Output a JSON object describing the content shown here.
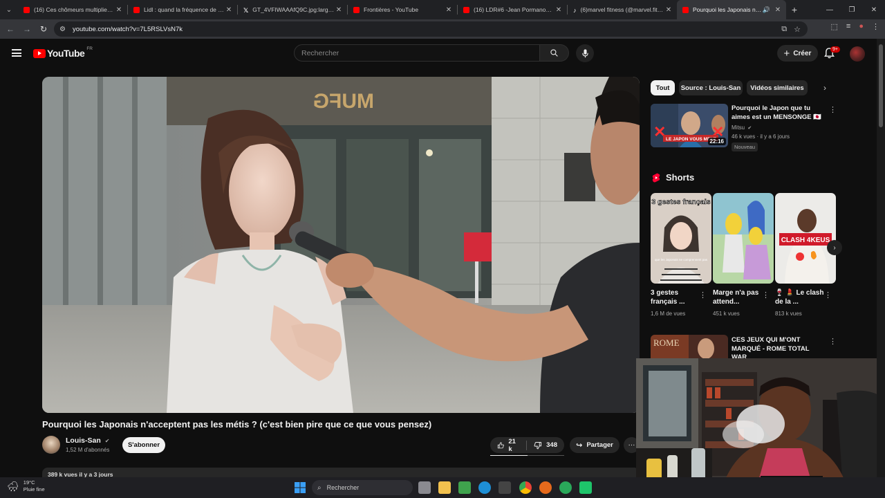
{
  "browser": {
    "tabs": [
      {
        "title": "(16) Ces chômeurs multiplient l...",
        "favicon": "youtube-icon",
        "color": "#ff0000"
      },
      {
        "title": "Lidl : quand la fréquence de tra...",
        "favicon": "youtube-icon",
        "color": "#ff0000"
      },
      {
        "title": "GT_4VFIWAAAfQ9C.jpg:large (...",
        "favicon": "x-icon",
        "color": "#ffffff"
      },
      {
        "title": "Frontières - YouTube",
        "favicon": "youtube-icon",
        "color": "#ff0000"
      },
      {
        "title": "(16) LDR#6 -Jean Pormanove -...",
        "favicon": "youtube-icon",
        "color": "#ff0000"
      },
      {
        "title": "(6)marvel fitness (@marvel.fit) |...",
        "favicon": "tiktok-icon",
        "color": "#ffffff"
      },
      {
        "title": "Pourquoi les Japonais n'acc...",
        "favicon": "youtube-icon",
        "color": "#ff0000",
        "active": true
      }
    ],
    "url": "youtube.com/watch?v=7L5RSLVsN7k"
  },
  "header": {
    "logo_text": "YouTube",
    "country_code": "FR",
    "search_placeholder": "Rechercher",
    "create_label": "Créer",
    "notifications_badge": "9+"
  },
  "video": {
    "title": "Pourquoi les Japonais n'acceptent pas les métis ? (c'est bien pire que ce que vous pensez)",
    "channel": "Louis-San",
    "subscribers": "1,52 M d'abonnés",
    "subscribe_label": "S'abonner",
    "likes": "21 k",
    "dislikes": "348",
    "share_label": "Partager",
    "views_date": "389 k vues  il y a 3 jours"
  },
  "sidebar": {
    "chips": [
      "Tout",
      "Source : Louis-San",
      "Vidéos similaires"
    ],
    "recommended": [
      {
        "title": "Pourquoi le Japon que tu aimes est un MENSONGE 🇯🇵",
        "channel": "Mitsu",
        "meta": "46 k vues · il y a 6 jours",
        "duration": "22:16",
        "badge": "Nouveau",
        "thumb_text": "LE JAPON VOUS MENT"
      },
      {
        "title": "CES JEUX QUI M'ONT MARQUÉ - ROME TOTAL WAR",
        "thumb_text": "ROME"
      }
    ],
    "shorts_label": "Shorts",
    "shorts": [
      {
        "title": "3 gestes français ...",
        "views": "1,6 M de vues",
        "thumb_text": "3 gestes français",
        "thumb_sub": "que les Japonais ne comprennent pas"
      },
      {
        "title": "Marge n'a pas attend...",
        "views": "451 k vues"
      },
      {
        "title": "🍷 💄 Le clash de la ...",
        "views": "813 k vues",
        "thumb_text": "CLASH 4KEUS"
      }
    ]
  },
  "player_scene": {
    "sign_text": "MUFG"
  },
  "taskbar": {
    "temperature": "19°C",
    "weather": "Pluie fine",
    "search_label": "Rechercher"
  }
}
